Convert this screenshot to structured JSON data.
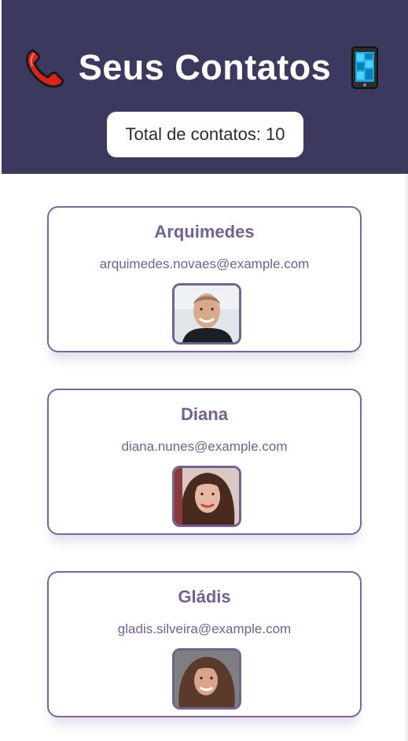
{
  "header": {
    "title": "Seus Contatos",
    "left_icon": "telephone-receiver-icon",
    "right_icon": "mobile-phone-icon",
    "count_label": "Total de contatos: 10",
    "background_color": "#3b3a5e"
  },
  "contacts": [
    {
      "name": "Arquimedes",
      "email": "arquimedes.novaes@example.com",
      "avatar": "photo-man-short-hair"
    },
    {
      "name": "Diana",
      "email": "diana.nunes@example.com",
      "avatar": "photo-woman-dark-hair"
    },
    {
      "name": "Gládis",
      "email": "gladis.silveira@example.com",
      "avatar": "photo-woman-curly-hair"
    }
  ],
  "colors": {
    "accent": "#75608f",
    "card_border": "#7a6797",
    "text_dark": "#2b2b38"
  }
}
